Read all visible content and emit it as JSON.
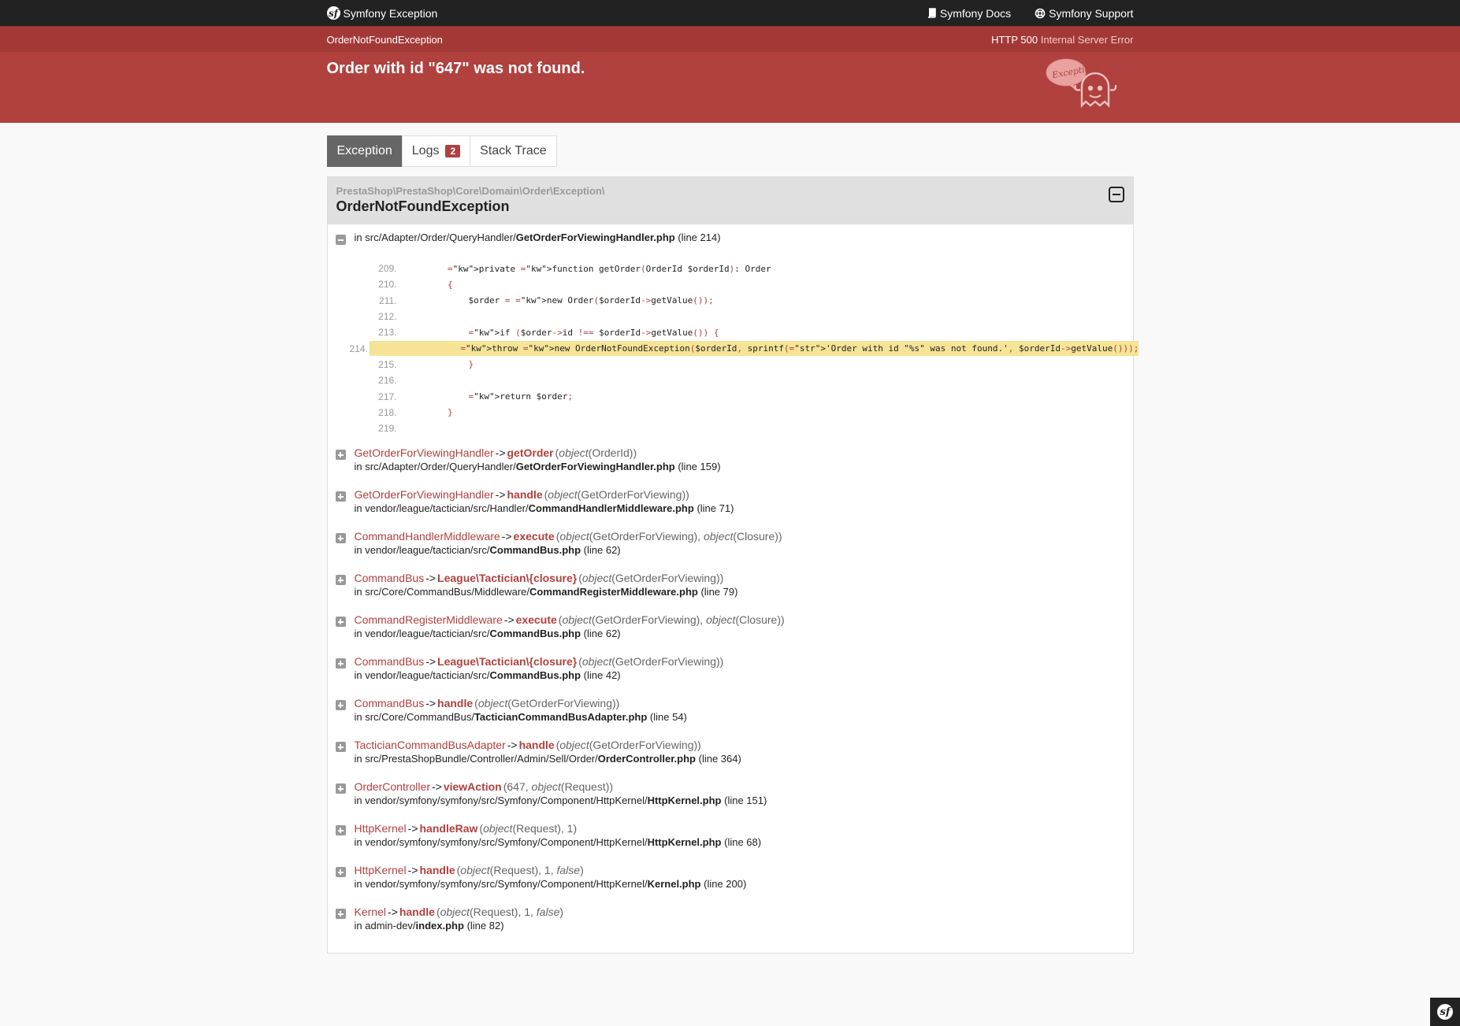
{
  "header": {
    "brand": "Symfony Exception",
    "docs": "Symfony Docs",
    "support": "Symfony Support"
  },
  "summary": {
    "exception_class": "OrderNotFoundException",
    "status_code": "HTTP 500",
    "status_text": "Internal Server Error",
    "message": "Order with id \"647\" was not found.",
    "ghost_text": "Exception!"
  },
  "tabs": {
    "exception": "Exception",
    "logs": "Logs",
    "logs_count": "2",
    "stack_trace": "Stack Trace"
  },
  "trace": {
    "namespace": "PrestaShop\\PrestaShop\\Core\\Domain\\Order\\Exception\\",
    "class": "OrderNotFoundException",
    "first_frame": {
      "in": "in ",
      "dir": "src/Adapter/Order/QueryHandler/",
      "file": "GetOrderForViewingHandler.php",
      "line": "(line 214)"
    },
    "code": [
      {
        "n": "209.",
        "t": "    private function getOrder(OrderId $orderId): Order"
      },
      {
        "n": "210.",
        "t": "    {"
      },
      {
        "n": "211.",
        "t": "        $order = new Order($orderId->getValue());"
      },
      {
        "n": "212.",
        "t": ""
      },
      {
        "n": "213.",
        "t": "        if ($order->id !== $orderId->getValue()) {"
      },
      {
        "n": "214.",
        "t": "            throw new OrderNotFoundException($orderId, sprintf('Order with id \"%s\" was not found.', $orderId->getValue()));"
      },
      {
        "n": "215.",
        "t": "        }"
      },
      {
        "n": "216.",
        "t": ""
      },
      {
        "n": "217.",
        "t": "        return $order;"
      },
      {
        "n": "218.",
        "t": "    }"
      },
      {
        "n": "219.",
        "t": ""
      }
    ],
    "highlight_line": "214.",
    "frames": [
      {
        "cls": "GetOrderForViewingHandler",
        "method": "getOrder",
        "args": "(object(OrderId))",
        "dir": "in src/Adapter/Order/QueryHandler/",
        "file": "GetOrderForViewingHandler.php",
        "line": "(line 159)"
      },
      {
        "cls": "GetOrderForViewingHandler",
        "method": "handle",
        "args": "(object(GetOrderForViewing))",
        "dir": "in vendor/league/tactician/src/Handler/",
        "file": "CommandHandlerMiddleware.php",
        "line": "(line 71)"
      },
      {
        "cls": "CommandHandlerMiddleware",
        "method": "execute",
        "args": "(object(GetOrderForViewing), object(Closure))",
        "dir": "in vendor/league/tactician/src/",
        "file": "CommandBus.php",
        "line": "(line 62)"
      },
      {
        "cls": "CommandBus",
        "method": "League\\Tactician\\{closure}",
        "args": "(object(GetOrderForViewing))",
        "dir": "in src/Core/CommandBus/Middleware/",
        "file": "CommandRegisterMiddleware.php",
        "line": "(line 79)"
      },
      {
        "cls": "CommandRegisterMiddleware",
        "method": "execute",
        "args": "(object(GetOrderForViewing), object(Closure))",
        "dir": "in vendor/league/tactician/src/",
        "file": "CommandBus.php",
        "line": "(line 62)"
      },
      {
        "cls": "CommandBus",
        "method": "League\\Tactician\\{closure}",
        "args": "(object(GetOrderForViewing))",
        "dir": "in vendor/league/tactician/src/",
        "file": "CommandBus.php",
        "line": "(line 42)"
      },
      {
        "cls": "CommandBus",
        "method": "handle",
        "args": "(object(GetOrderForViewing))",
        "dir": "in src/Core/CommandBus/",
        "file": "TacticianCommandBusAdapter.php",
        "line": "(line 54)"
      },
      {
        "cls": "TacticianCommandBusAdapter",
        "method": "handle",
        "args": "(object(GetOrderForViewing))",
        "dir": "in src/PrestaShopBundle/Controller/Admin/Sell/Order/",
        "file": "OrderController.php",
        "line": "(line 364)"
      },
      {
        "cls": "OrderController",
        "method": "viewAction",
        "args": "(647, object(Request))",
        "dir": "in vendor/symfony/symfony/src/Symfony/Component/HttpKernel/",
        "file": "HttpKernel.php",
        "line": "(line 151)"
      },
      {
        "cls": "HttpKernel",
        "method": "handleRaw",
        "args": "(object(Request), 1)",
        "dir": "in vendor/symfony/symfony/src/Symfony/Component/HttpKernel/",
        "file": "HttpKernel.php",
        "line": "(line 68)"
      },
      {
        "cls": "HttpKernel",
        "method": "handle",
        "args": "(object(Request), 1, false)",
        "dir": "in vendor/symfony/symfony/src/Symfony/Component/HttpKernel/",
        "file": "Kernel.php",
        "line": "(line 200)"
      },
      {
        "cls": "Kernel",
        "method": "handle",
        "args": "(object(Request), 1, false)",
        "dir": "in admin-dev/",
        "file": "index.php",
        "line": "(line 82)"
      }
    ]
  },
  "colors": {
    "accent": "#b0413e",
    "topbar": "#222222",
    "highlight": "#f5e496"
  }
}
